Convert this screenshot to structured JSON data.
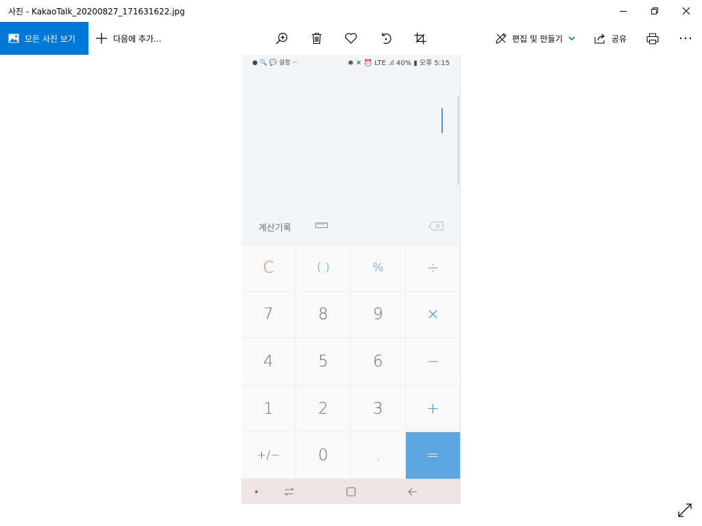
{
  "window": {
    "title": "사진 - KakaoTalk_20200827_171631622.jpg",
    "controls": [
      "minimize-icon",
      "restore-icon",
      "close-icon"
    ]
  },
  "toolbar": {
    "all_photos_label": "모든 사진 보기",
    "add_to_label": "다음에 추가...",
    "icons": [
      "zoom-in-icon",
      "delete-icon",
      "heart-icon",
      "rotate-icon",
      "crop-icon"
    ],
    "edit_create_label": "편집 및 만들기",
    "share_label": "공유",
    "print_icon": "print-icon",
    "more_icon": "more-icon",
    "accent_color": "#0078d7"
  },
  "phone": {
    "status_left": "● 🔍 💬 설정  ···",
    "status_right": "✱ ✕ ⏰ LTE .ıl 40% ▮ 오후 5:15",
    "history_label": "계산기록",
    "keys": [
      [
        "C",
        "( )",
        "%",
        "÷"
      ],
      [
        "7",
        "8",
        "9",
        "×"
      ],
      [
        "4",
        "5",
        "6",
        "−"
      ],
      [
        "1",
        "2",
        "3",
        "+"
      ],
      [
        "+/−",
        "0",
        ".",
        "="
      ]
    ],
    "equals_color": "#5aa6e2",
    "operator_color": "#3d8fc9",
    "clear_color": "#e07850",
    "nav_bar_color": "#efe4e4"
  },
  "expand_icon": "expand-icon"
}
